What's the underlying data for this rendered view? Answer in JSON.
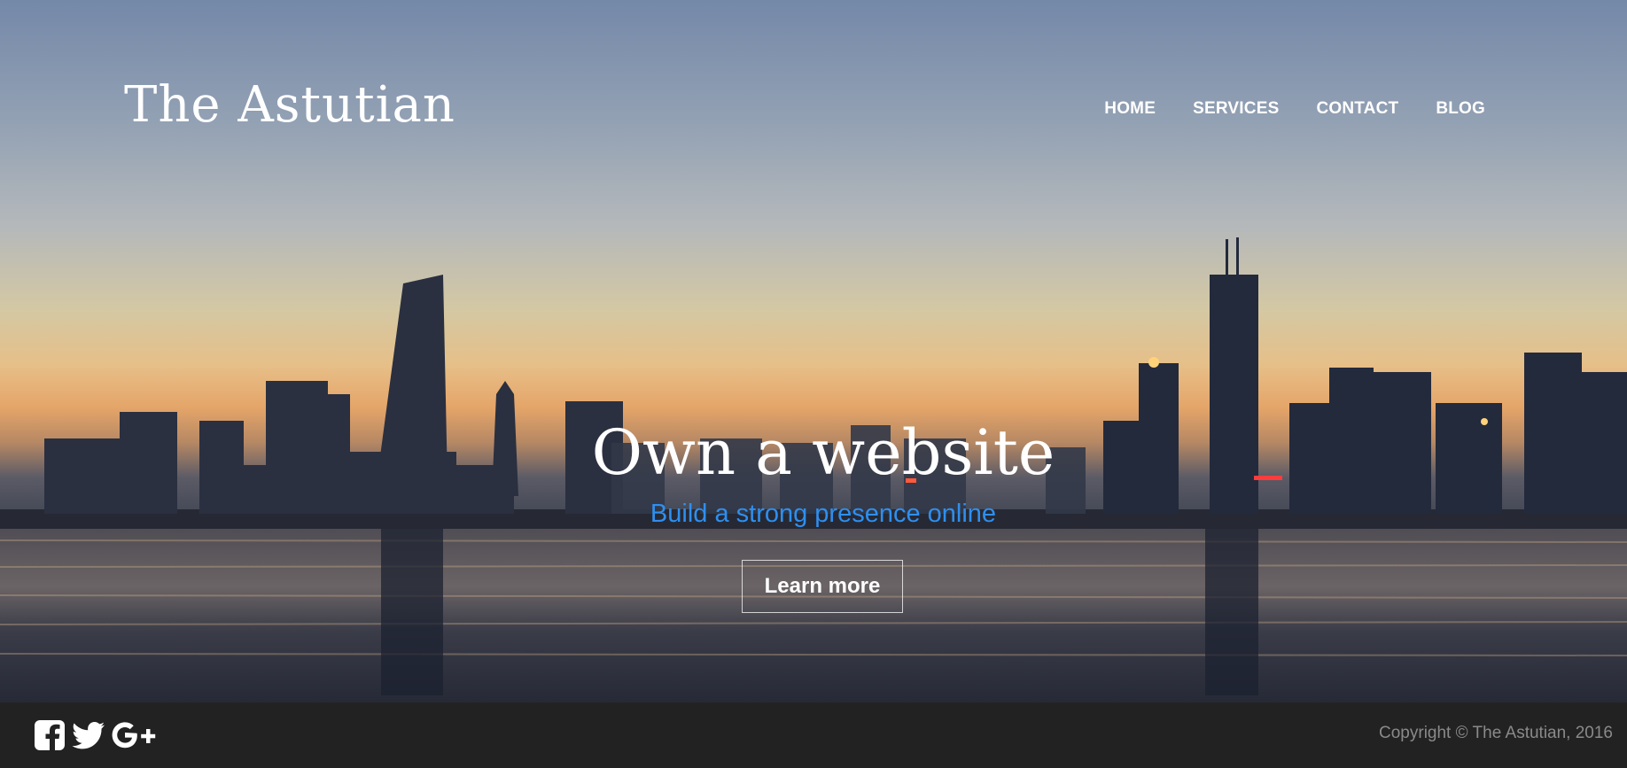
{
  "header": {
    "brand": "The Astutian",
    "nav": [
      {
        "label": "HOME"
      },
      {
        "label": "SERVICES"
      },
      {
        "label": "CONTACT"
      },
      {
        "label": "BLOG"
      }
    ]
  },
  "hero": {
    "headline": "Own a website",
    "subheadline": "Build a strong presence online",
    "cta_label": "Learn more",
    "background": "city skyline at dusk over water"
  },
  "footer": {
    "social_icons": [
      "facebook-icon",
      "twitter-icon",
      "google-plus-icon"
    ],
    "copyright": "Copyright © The Astutian, 2016"
  },
  "colors": {
    "subheadline": "#2e8ff0",
    "footer_bg": "#222222",
    "copyright_text": "#8a8a8a",
    "text": "#ffffff"
  }
}
